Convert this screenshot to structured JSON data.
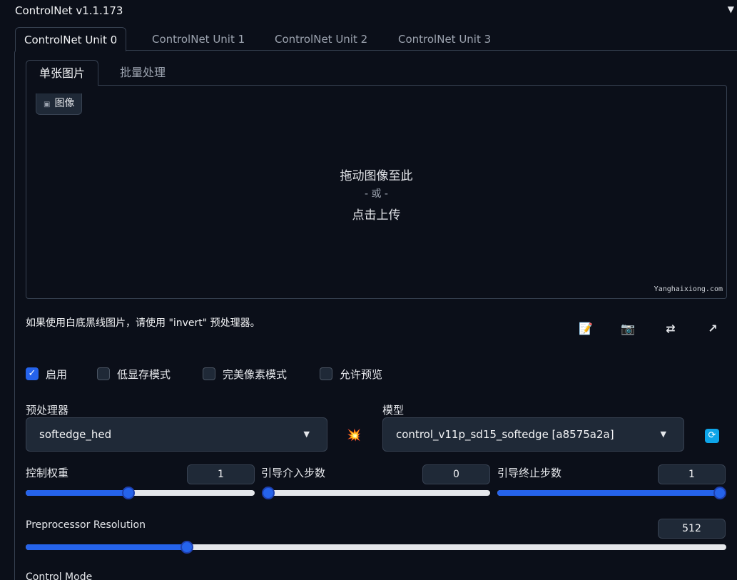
{
  "header": {
    "title": "ControlNet v1.1.173",
    "collapse_icon": "triangle-down-icon"
  },
  "unit_tabs": [
    "ControlNet Unit 0",
    "ControlNet Unit 1",
    "ControlNet Unit 2",
    "ControlNet Unit 3"
  ],
  "image_tabs": [
    "单张图片",
    "批量处理"
  ],
  "dropzone": {
    "label": "图像",
    "line1": "拖动图像至此",
    "line2": "- 或 -",
    "line3": "点击上传",
    "watermark": "Yanghaixiong.com"
  },
  "hint": "如果使用白底黑线图片，请使用 \"invert\" 预处理器。",
  "tool_icons": [
    "notepad-icon",
    "camera-icon",
    "swap-icon",
    "send-arrow-icon"
  ],
  "checkboxes": [
    {
      "label": "启用",
      "checked": true
    },
    {
      "label": "低显存模式",
      "checked": false
    },
    {
      "label": "完美像素模式",
      "checked": false
    },
    {
      "label": "允许预览",
      "checked": false
    }
  ],
  "preprocessor": {
    "label": "预处理器",
    "value": "softedge_hed"
  },
  "model": {
    "label": "模型",
    "value": "control_v11p_sd15_softedge [a8575a2a]"
  },
  "sliders": {
    "weight": {
      "label": "控制权重",
      "value": "1",
      "fraction": 0.45
    },
    "start": {
      "label": "引导介入步数",
      "value": "0",
      "fraction": 0.0
    },
    "end": {
      "label": "引导终止步数",
      "value": "1",
      "fraction": 1.0
    },
    "resolution": {
      "label": "Preprocessor Resolution",
      "value": "512",
      "fraction": 0.23
    }
  },
  "next_section": "Control Mode",
  "colors": {
    "accent": "#2563eb",
    "background": "#0b0f19",
    "panel": "#1f2937",
    "border": "#374151"
  }
}
